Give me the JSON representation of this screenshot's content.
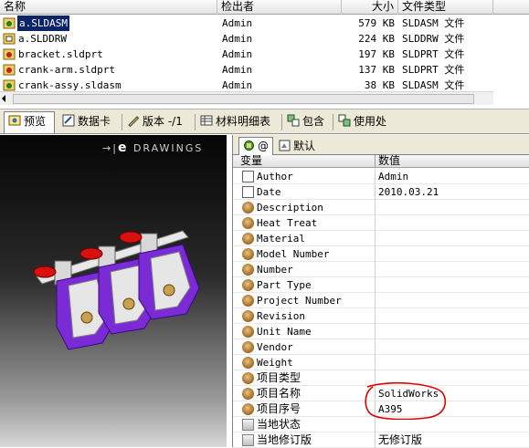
{
  "file_list": {
    "columns": [
      "名称",
      "检出者",
      "大小",
      "文件类型"
    ],
    "rows": [
      {
        "name": "a.SLDASM",
        "checked_out_by": "Admin",
        "size": "579 KB",
        "type": "SLDASM 文件",
        "selected": true
      },
      {
        "name": "a.SLDDRW",
        "checked_out_by": "Admin",
        "size": "224 KB",
        "type": "SLDDRW 文件",
        "selected": false
      },
      {
        "name": "bracket.sldprt",
        "checked_out_by": "Admin",
        "size": "197 KB",
        "type": "SLDPRT 文件",
        "selected": false
      },
      {
        "name": "crank-arm.sldprt",
        "checked_out_by": "Admin",
        "size": "137 KB",
        "type": "SLDPRT 文件",
        "selected": false
      },
      {
        "name": "crank-assy.sldasm",
        "checked_out_by": "Admin",
        "size": "38 KB",
        "type": "SLDASM 文件",
        "selected": false
      }
    ]
  },
  "tabs": [
    {
      "label": "预览",
      "icon": "preview-icon",
      "active": true
    },
    {
      "label": "数据卡",
      "icon": "datacard-icon",
      "active": false
    },
    {
      "label": "版本 -/1",
      "icon": "version-icon",
      "active": false
    },
    {
      "label": "材料明细表",
      "icon": "bom-icon",
      "active": false
    },
    {
      "label": "包含",
      "icon": "contains-icon",
      "active": false
    },
    {
      "label": "使用处",
      "icon": "where-used-icon",
      "active": false
    }
  ],
  "preview": {
    "logo_text": "DRAWINGS"
  },
  "properties": {
    "config_tabs": [
      {
        "label": "@",
        "icon": "config-icon",
        "active": true
      },
      {
        "label": "默认",
        "icon": "default-config-icon",
        "active": false
      }
    ],
    "columns": [
      "变量",
      "数值"
    ],
    "rows": [
      {
        "name": "Author",
        "value": "Admin",
        "icon": "doc-icon"
      },
      {
        "name": "Date",
        "value": "2010.03.21",
        "icon": "doc-icon"
      },
      {
        "name": "Description",
        "value": "",
        "icon": "gear-icon"
      },
      {
        "name": "Heat Treat",
        "value": "",
        "icon": "gear-icon"
      },
      {
        "name": "Material",
        "value": "",
        "icon": "gear-icon"
      },
      {
        "name": "Model Number",
        "value": "",
        "icon": "gear-icon"
      },
      {
        "name": "Number",
        "value": "",
        "icon": "gear-icon"
      },
      {
        "name": "Part Type",
        "value": "",
        "icon": "gear-icon"
      },
      {
        "name": "Project Number",
        "value": "",
        "icon": "gear-icon"
      },
      {
        "name": "Revision",
        "value": "",
        "icon": "gear-icon"
      },
      {
        "name": "Unit Name",
        "value": "",
        "icon": "gear-icon"
      },
      {
        "name": "Vendor",
        "value": "",
        "icon": "gear-icon"
      },
      {
        "name": "Weight",
        "value": "",
        "icon": "gear-icon"
      },
      {
        "name": "项目类型",
        "value": "",
        "icon": "gear-icon"
      },
      {
        "name": "项目名称",
        "value": "SolidWorks",
        "icon": "gear-icon"
      },
      {
        "name": "项目序号",
        "value": "A395",
        "icon": "gear-icon"
      },
      {
        "name": "当地状态",
        "value": "",
        "icon": "status-icon"
      },
      {
        "name": "当地修订版",
        "value": "无修订版",
        "icon": "status-icon"
      }
    ]
  },
  "colors": {
    "selection": "#0a246a",
    "tab_bar": "#ece9d8",
    "annotation_red": "#e00000",
    "part_purple": "#7a2bd6"
  }
}
